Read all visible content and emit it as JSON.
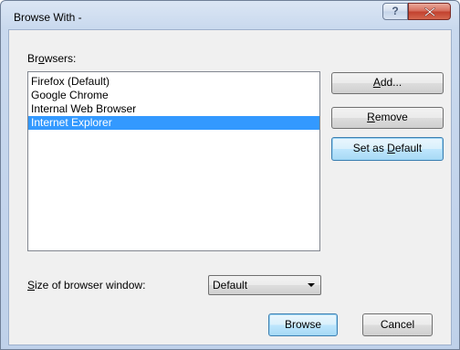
{
  "window": {
    "title": "Browse With -",
    "help_glyph": "?",
    "close_icon": "close-icon"
  },
  "browsers": {
    "label_pre": "Br",
    "label_key": "o",
    "label_post": "wsers:",
    "items": [
      {
        "label": "Firefox (Default)",
        "selected": false
      },
      {
        "label": "Google Chrome",
        "selected": false
      },
      {
        "label": "Internal Web Browser",
        "selected": false
      },
      {
        "label": "Internet Explorer",
        "selected": true
      }
    ]
  },
  "buttons": {
    "add_key": "A",
    "add_rest": "dd...",
    "remove_key": "R",
    "remove_rest": "emove",
    "set_default_pre": "Set as ",
    "set_default_key": "D",
    "set_default_rest": "efault",
    "browse": "Browse",
    "cancel": "Cancel"
  },
  "window_size": {
    "label_key": "S",
    "label_rest": "ize of browser window:",
    "selected": "Default"
  },
  "colors": {
    "selection": "#3399ff",
    "close_button": "#c2422f"
  }
}
